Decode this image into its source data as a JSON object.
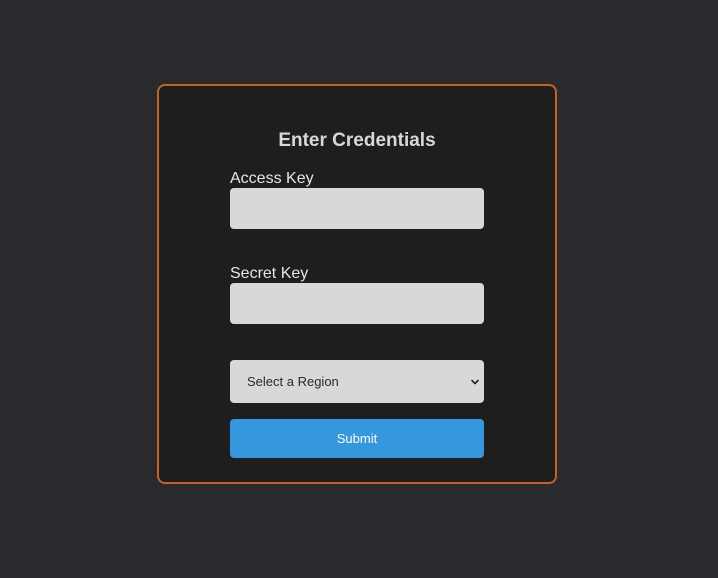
{
  "form": {
    "title": "Enter Credentials",
    "access_key_label": "Access Key",
    "access_key_value": "",
    "secret_key_label": "Secret Key",
    "secret_key_value": "",
    "region_selected": "Select a Region",
    "submit_label": "Submit"
  },
  "colors": {
    "page_background": "#292a2e",
    "card_background": "#1e1e1e",
    "card_border": "#c8621f",
    "input_background": "#d8d8d8",
    "submit_background": "#3597dd"
  },
  "icons": {
    "select_arrow": "chevron-down-icon"
  }
}
